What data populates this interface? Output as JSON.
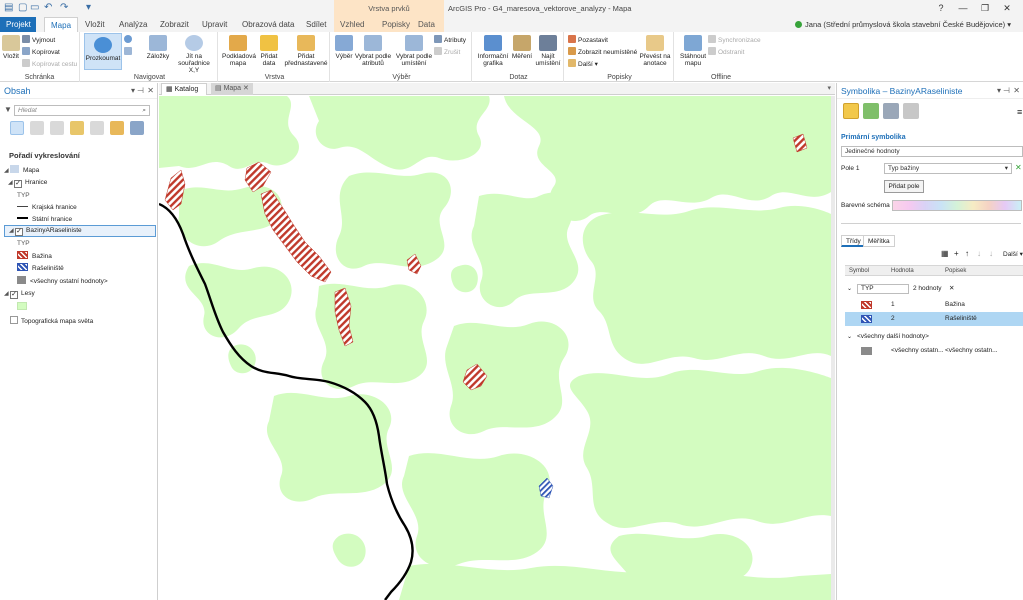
{
  "window": {
    "title": "ArcGIS Pro - G4_maresova_vektorove_analyzy - Mapa",
    "context_tab_header": "Vrstva prvků",
    "help": "?",
    "min": "—",
    "max": "❐",
    "close": "✕"
  },
  "ribbon_tabs": [
    "Projekt",
    "Mapa",
    "Vložit",
    "Analýza",
    "Zobrazit",
    "Upravit",
    "Obrazová data",
    "Sdílet",
    "Vzhled",
    "Popisky",
    "Data"
  ],
  "user": "Jana (Střední průmyslová škola stavební České Budějovice)",
  "ribbon": {
    "clipboard": {
      "label": "Schránka",
      "paste": "Vložit",
      "cut": "Vyjmout",
      "copy": "Kopírovat",
      "copy_path": "Kopírovat cestu"
    },
    "navigate": {
      "label": "Navigovat",
      "explore": "Prozkoumat",
      "bookmarks": "Záložky",
      "goto_xy": "Jít na souřadnice X,Y"
    },
    "layer": {
      "label": "Vrstva",
      "basemap": "Podkladová mapa",
      "add_data": "Přidat data",
      "add_preset": "Přidat přednastavené"
    },
    "selection": {
      "label": "Výběr",
      "select": "Výběr",
      "by_attributes": "Vybrat podle atributů",
      "by_location": "Vybrat podle umístění",
      "attributes": "Atributy",
      "clear": "Zrušit"
    },
    "inquiry": {
      "label": "Dotaz",
      "infographics": "Informační grafika",
      "measure": "Měření",
      "locate": "Najít umístění"
    },
    "labeling": {
      "label": "Popisky",
      "pause": "Pozastavit",
      "unplaced": "Zobrazit neumístěné",
      "more": "Další",
      "convert": "Převést na anotace"
    },
    "offline": {
      "label": "Offline",
      "download": "Stáhnout mapu",
      "sync": "Synchronizace",
      "remove": "Odstranit"
    }
  },
  "contents": {
    "title": "Obsah",
    "search_placeholder": "Hledat",
    "drawing_order": "Pořadí vykreslování",
    "map_name": "Mapa",
    "layers": {
      "hranice": "Hranice",
      "hranice_field": "TYP",
      "krajska": "Krajská hranice",
      "statni": "Státní hranice",
      "baziny": "BazinyARaseliniste",
      "baziny_field": "TYP",
      "bazina": "Bažina",
      "raseliniste": "Rašeliniště",
      "other": "<všechny ostatní hodnoty>",
      "lesy": "Lesy",
      "topo": "Topografická mapa světa"
    }
  },
  "map_tabs": {
    "catalog": "Katalog",
    "map": "Mapa"
  },
  "symbology": {
    "title": "Symbolika – BazinyARaseliniste",
    "primary": "Primární symbolika",
    "method": "Jedinečné hodnoty",
    "field1_label": "Pole 1",
    "field1_value": "Typ bažiny",
    "add_field": "Přidat pole",
    "color_scheme_label": "Barevné schéma",
    "tabs": [
      "Třídy",
      "Měřítka"
    ],
    "more": "Další",
    "columns": [
      "Symbol",
      "Hodnota",
      "Popisek"
    ],
    "group_field": "TYP",
    "group_count": "2 hodnoty",
    "rows": [
      {
        "value": "1",
        "label": "Bažina"
      },
      {
        "value": "2",
        "label": "Rašeliniště"
      }
    ],
    "other_header": "<všechny další hodnoty>",
    "other_value": "<všechny ostatn...",
    "other_label": "<všechny ostatn..."
  },
  "colors": {
    "forest": "#d3fcc0",
    "bazina": "#c0392b",
    "raseliniste": "#2f55b5",
    "border": "#000000",
    "accent": "#1d6fb8"
  }
}
